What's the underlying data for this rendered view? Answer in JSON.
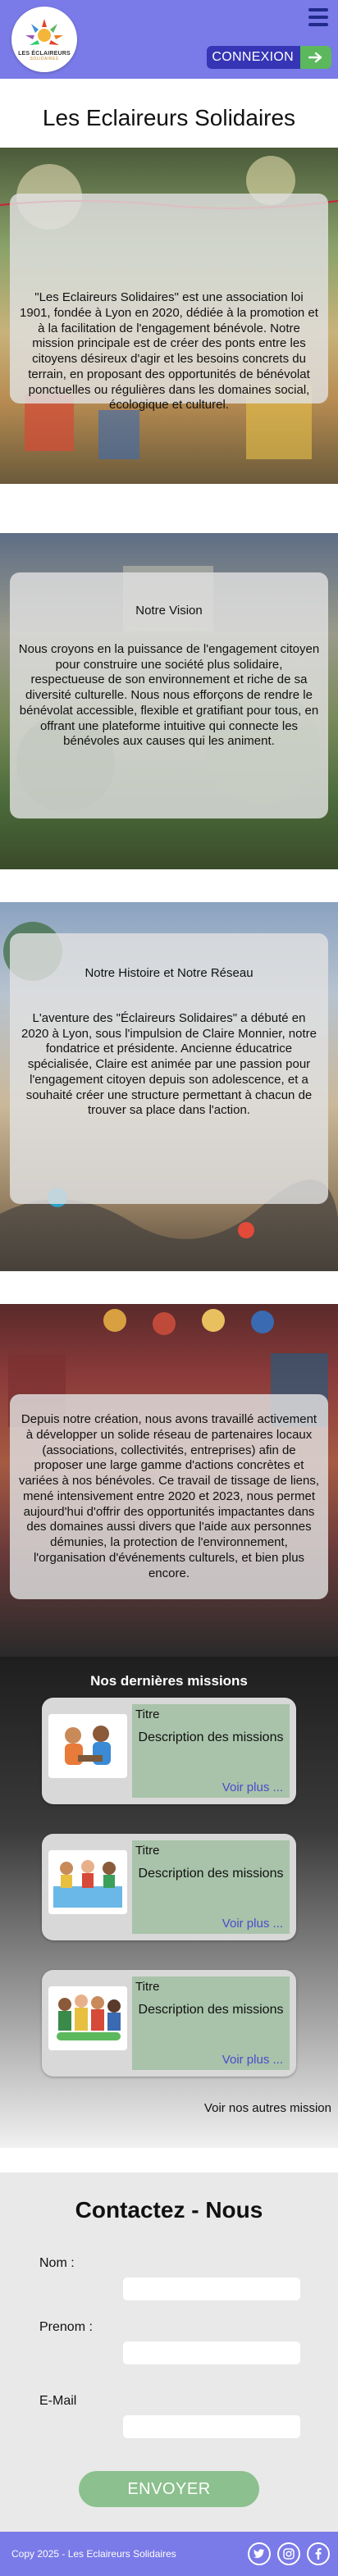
{
  "header": {
    "logo_text": "LES ÉCLAIREURS",
    "logo_sub": "SOLIDAIRES",
    "connect_label": "CONNEXION"
  },
  "site_title": "Les Eclaireurs Solidaires",
  "sections": {
    "about": "\"Les Eclaireurs Solidaires\" est une association loi 1901, fondée à Lyon en 2020, dédiée à la promotion et à la facilitation de l'engagement bénévole. Notre mission principale est de créer des ponts entre les citoyens désireux d'agir et les besoins concrets du terrain, en proposant des opportunités de bénévolat ponctuelles ou régulières dans les domaines social, écologique et culturel.",
    "vision_title": "Notre Vision",
    "vision_text": "Nous croyons en la puissance de l'engagement citoyen pour construire une société plus solidaire, respectueuse de son environnement et riche de sa diversité culturelle. Nous nous efforçons de rendre le bénévolat accessible, flexible et gratifiant pour tous, en offrant une plateforme intuitive qui connecte les bénévoles aux causes qui les animent.",
    "history_title": "Notre Histoire et Notre Réseau",
    "history_text": "L'aventure des \"Éclaireurs Solidaires\" a débuté en 2020 à Lyon, sous l'impulsion de Claire Monnier, notre fondatrice et présidente. Ancienne éducatrice spécialisée, Claire est animée par une passion pour l'engagement citoyen depuis son adolescence, et a souhaité créer une structure permettant à chacun de trouver sa place dans l'action.",
    "network_text": "Depuis notre création, nous avons travaillé activement à développer un solide réseau de partenaires  locaux (associations, collectivités, entreprises) afin de proposer une large gamme d'actions concrètes et variées à nos bénévoles. Ce travail de tissage de liens, mené intensivement entre 2020 et 2023, nous permet aujourd'hui d'offrir des opportunités impactantes dans des domaines aussi divers que l'aide aux personnes démunies, la protection de l'environnement, l'organisation d'événements culturels, et bien plus encore."
  },
  "missions": {
    "heading": "Nos dernières missions",
    "items": [
      {
        "title": "Titre",
        "description": "Description des missions",
        "more": "Voir plus ..."
      },
      {
        "title": "Titre",
        "description": "Description des missions",
        "more": "Voir plus ..."
      },
      {
        "title": "Titre",
        "description": "Description des missions",
        "more": "Voir plus ..."
      }
    ],
    "other_link": "Voir nos autres mission"
  },
  "contact": {
    "title": "Contactez - Nous",
    "nom_label": "Nom :",
    "prenom_label": "Prenom :",
    "email_label": "E-Mail",
    "send_label": "ENVOYER"
  },
  "footer": {
    "copyright": "Copy 2025 - Les Eclaireurs Solidaires"
  },
  "colors": {
    "header_bg": "#7a7ae8",
    "connect_bg": "#3535b5",
    "accent_green": "#5cb85c",
    "mission_body": "#a8c3a9",
    "link_blue": "#4a4acc"
  },
  "icons": [
    "menu-icon",
    "arrow-right-icon",
    "twitter-icon",
    "instagram-icon",
    "facebook-icon"
  ]
}
